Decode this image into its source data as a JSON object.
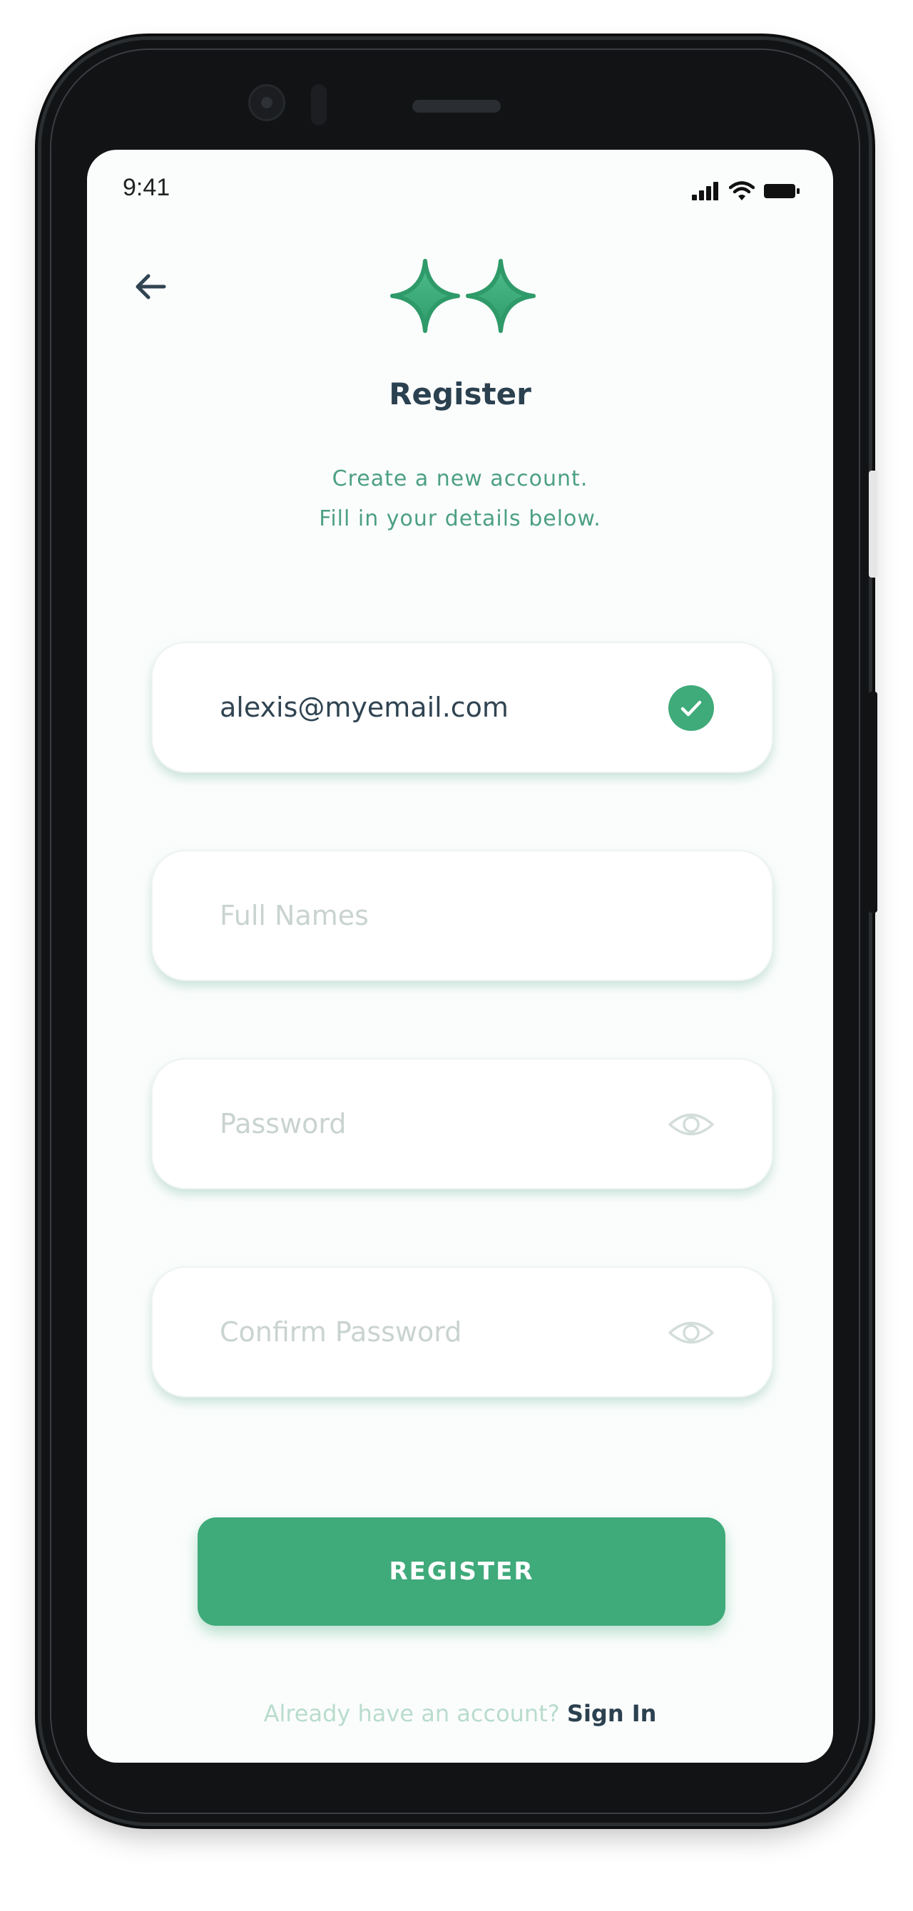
{
  "status_bar": {
    "time": "9:41",
    "icons": [
      "signal-icon",
      "wifi-icon",
      "battery-icon"
    ]
  },
  "header": {
    "back_icon": "arrow-left-icon",
    "logo_icon": "double-plus-logo",
    "title": "Register",
    "subtitle_line1": "Create a new account.",
    "subtitle_line2": "Fill in your details below."
  },
  "form": {
    "email": {
      "value": "alexis@myemail.com",
      "status_icon": "check-circle-icon"
    },
    "full_name": {
      "value": "",
      "placeholder": "Full Names"
    },
    "password": {
      "value": "",
      "placeholder": "Password",
      "trailing_icon": "eye-icon"
    },
    "confirm_password": {
      "value": "",
      "placeholder": "Confirm Password",
      "trailing_icon": "eye-icon"
    }
  },
  "actions": {
    "register_label": "REGISTER"
  },
  "footer": {
    "question": "Already have an account?",
    "link_label": "Sign In"
  },
  "colors": {
    "accent": "#3faa7a",
    "title": "#2b4150",
    "subtitle": "#4ca084",
    "placeholder": "#c9d3cf",
    "background": "#fbfdfc"
  }
}
